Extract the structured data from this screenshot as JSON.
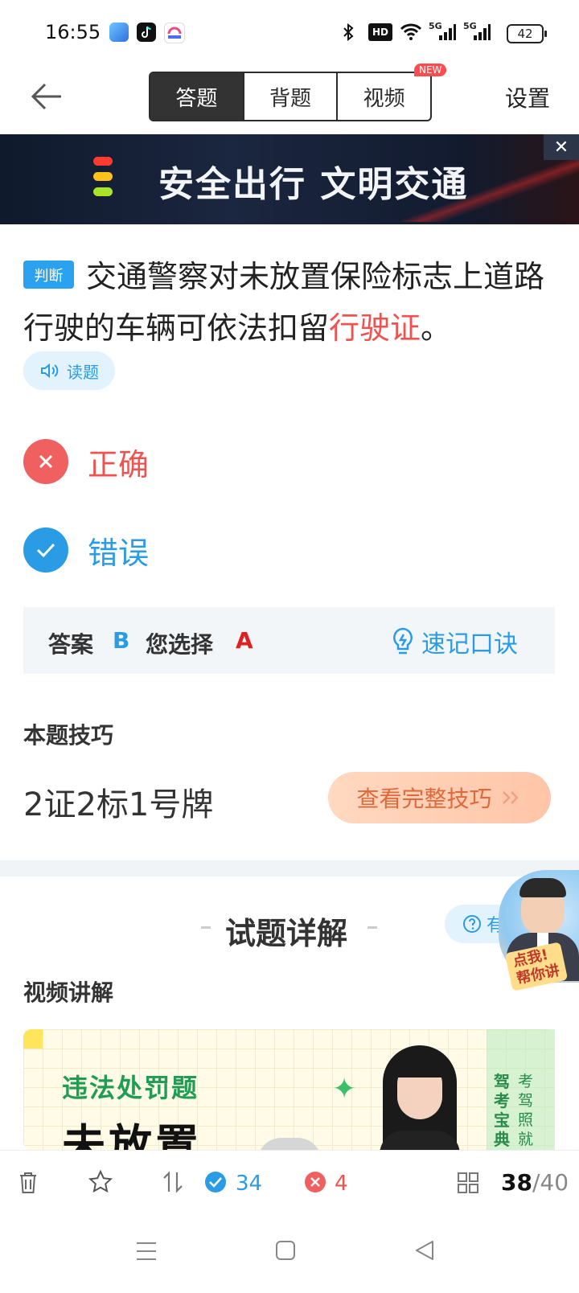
{
  "status_bar": {
    "time": "16:55",
    "network_1": "5G",
    "network_2": "5G",
    "hd_label": "HD",
    "battery": "42",
    "icons": [
      "app-icon-blue",
      "tiktok-icon",
      "app-icon-pink",
      "bluetooth-icon",
      "hd-icon",
      "wifi-icon",
      "signal-icon",
      "signal-icon",
      "battery-icon"
    ]
  },
  "header": {
    "back_icon": "arrow-left-icon",
    "tabs": [
      {
        "label": "答题",
        "active": true
      },
      {
        "label": "背题",
        "active": false
      },
      {
        "label": "视频",
        "active": false
      }
    ],
    "new_badge": "NEW",
    "settings_label": "设置"
  },
  "banner": {
    "text": "安全出行 文明交通",
    "close_icon": "close-icon"
  },
  "question": {
    "type_label": "判断",
    "text_main": "交通警察对未放置保险标志上道路行驶的车辆可依法扣留",
    "text_highlight": "行驶证",
    "text_end": "。",
    "read_label": "读题",
    "read_icon": "speaker-icon"
  },
  "options": [
    {
      "label": "正确",
      "state": "wrong",
      "icon": "close-icon",
      "color": "#f0534f"
    },
    {
      "label": "错误",
      "state": "correct",
      "icon": "check-icon",
      "color": "#2a9be5"
    }
  ],
  "answer": {
    "answer_label": "答案",
    "answer_value": "B",
    "choice_label": "您选择",
    "choice_value": "A",
    "mnemonic_label": "速记口诀",
    "mnemonic_icon": "lightbulb-icon"
  },
  "tips": {
    "title": "本题技巧",
    "text": "2证2标1号牌",
    "button_label": "查看完整技巧",
    "button_icon": "double-chevron-right-icon"
  },
  "detail": {
    "title": "试题详解",
    "help_label": "有",
    "help_icon": "question-circle-icon",
    "video_title": "视频讲解"
  },
  "video_card": {
    "title": "违法处罚题",
    "big_text": "未放置",
    "brand_a": "驾考宝典",
    "brand_b": "考驾照就用"
  },
  "tutor": {
    "tag_line1": "点我!",
    "tag_line2": "帮你讲"
  },
  "bottom_bar": {
    "correct_count": "34",
    "wrong_count": "4",
    "current": "38",
    "total": "/40",
    "icons": [
      "trash-icon",
      "star-icon",
      "swap-icon",
      "check-circle-icon",
      "close-circle-icon",
      "grid-icon"
    ]
  },
  "nav": {
    "icons": [
      "menu-icon",
      "home-icon",
      "back-triangle-icon"
    ]
  },
  "colors": {
    "accent_blue": "#2a9be5",
    "error_red": "#f0534f",
    "tab_active": "#333333"
  }
}
